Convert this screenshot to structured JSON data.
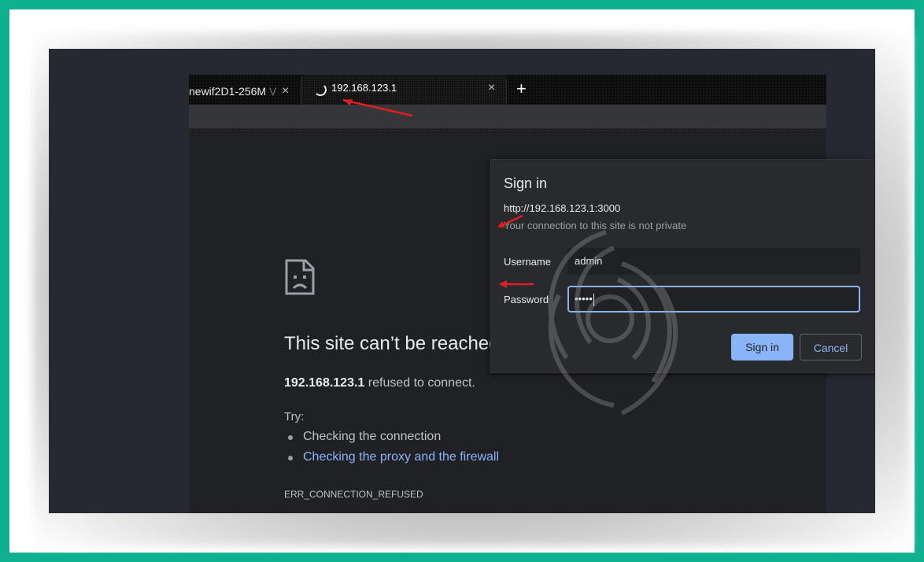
{
  "browser": {
    "tabs": [
      {
        "label": "newif2D1-256M",
        "label_fade": "V"
      },
      {
        "label": "192.168.123.1"
      }
    ],
    "close_glyph": "×",
    "new_tab_glyph": "+"
  },
  "error_page": {
    "title": "This site can’t be reached",
    "host": "192.168.123.1",
    "detail": " refused to connect.",
    "try_label": "Try:",
    "suggestions": [
      "Checking the connection",
      "Checking the proxy and the firewall"
    ],
    "error_code": "ERR_CONNECTION_REFUSED"
  },
  "dialog": {
    "title": "Sign in",
    "url": "http://192.168.123.1:3000",
    "note": "Your connection to this site is not private",
    "username_label": "Username",
    "username_value": "admin",
    "password_label": "Password",
    "password_value": "•••••",
    "signin_label": "Sign in",
    "cancel_label": "Cancel"
  },
  "colors": {
    "accent": "#8ab4f8",
    "annotation_arrow": "#e01e1e",
    "frame_border": "#0fb08f"
  },
  "icons": [
    "loading-spinner-icon",
    "close-icon",
    "plus-icon",
    "sad-page-icon",
    "watermark-logo-icon",
    "annotation-arrow-icon"
  ]
}
